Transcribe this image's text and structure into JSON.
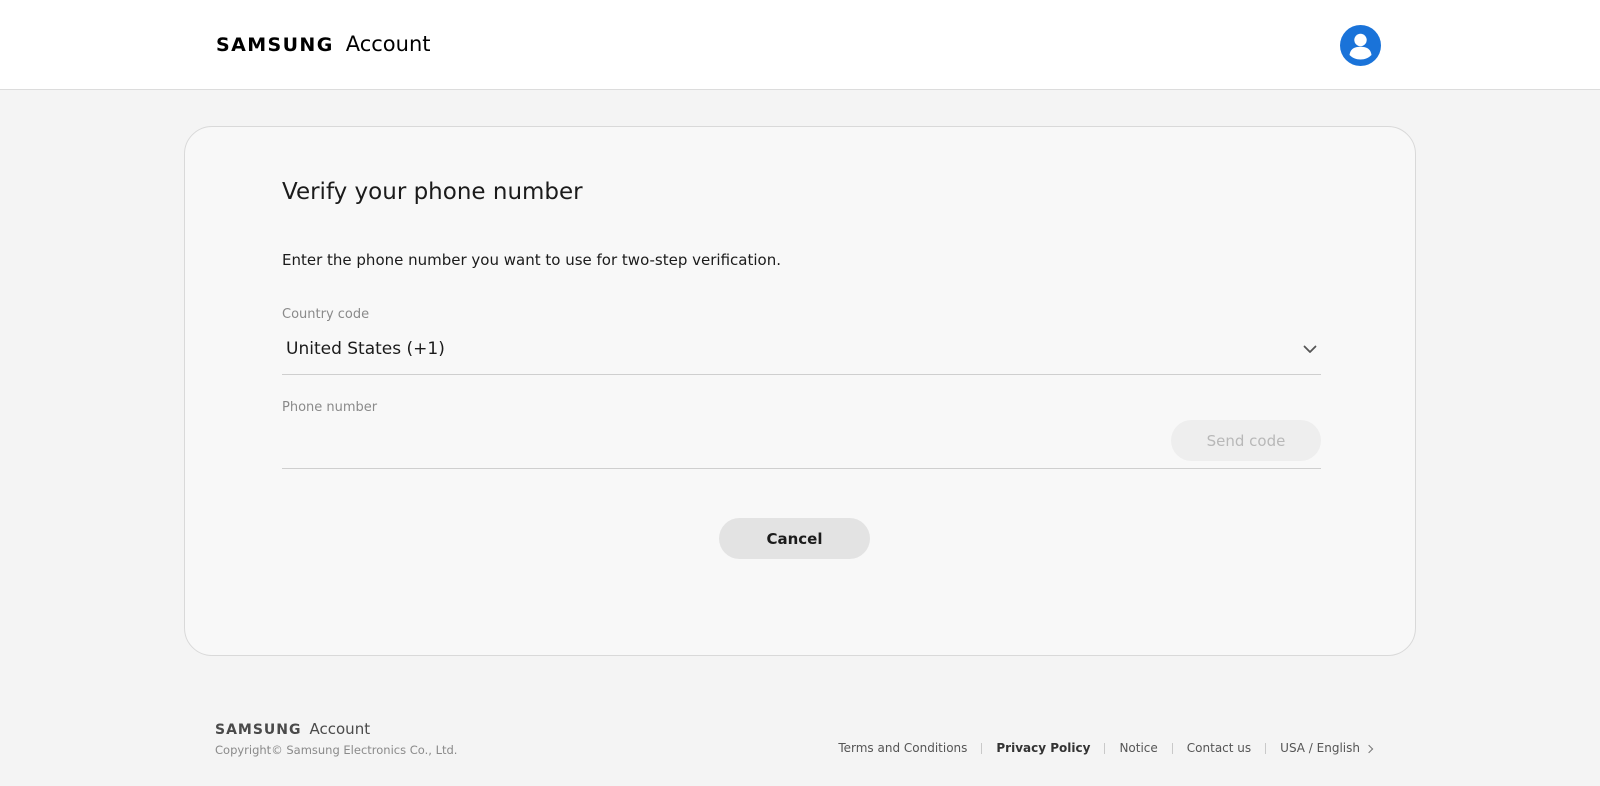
{
  "header": {
    "logo_brand": "SAMSUNG",
    "logo_product": "Account",
    "avatar_icon": "user-avatar-icon",
    "accent_color": "#1a73d9"
  },
  "verify": {
    "title": "Verify your phone number",
    "description": "Enter the phone number you want to use for two-step verification.",
    "country_label": "Country code",
    "country_value": "United States (+1)",
    "phone_label": "Phone number",
    "phone_value": "",
    "send_code_label": "Send code",
    "send_code_enabled": false,
    "cancel_label": "Cancel"
  },
  "footer": {
    "logo_brand": "SAMSUNG",
    "logo_product": "Account",
    "copyright": "Copyright© Samsung Electronics Co., Ltd.",
    "links": [
      {
        "label": "Terms and Conditions"
      },
      {
        "label": "Privacy Policy"
      },
      {
        "label": "Notice"
      },
      {
        "label": "Contact us"
      },
      {
        "label": "USA / English"
      }
    ]
  }
}
